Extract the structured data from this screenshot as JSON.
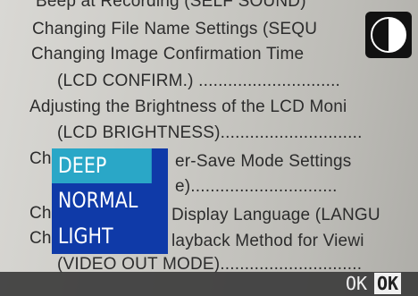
{
  "background_text": [
    "Beep at Recording (SELF SOUND)",
    "Changing File Name Settings (SEQU",
    "Changing Image Confirmation Time",
    "(LCD CONFIRM.) .............................",
    "Adjusting the Brightness of the LCD Moni",
    "(LCD BRIGHTNESS).............................",
    "Ch",
    "er-Save Mode Settings",
    "e)..............................",
    "Ch",
    "Display Language (LANGU",
    "Ch",
    "layback Method for Viewi",
    "(VIDEO OUT MODE)............................."
  ],
  "menu": {
    "items": [
      {
        "label": "DEEP",
        "selected": true
      },
      {
        "label": "NORMAL",
        "selected": false
      },
      {
        "label": "LIGHT",
        "selected": false
      }
    ]
  },
  "footer": {
    "ok_text": "OK",
    "ok_key": "OK"
  },
  "icons": {
    "contrast": "contrast-icon"
  },
  "colors": {
    "menu_bg": "#0f3aa8",
    "menu_selected": "#2aa7c7",
    "bar_bg": "#3c3c3c"
  }
}
